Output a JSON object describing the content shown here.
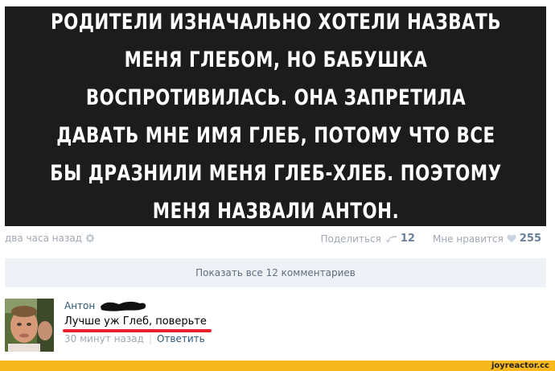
{
  "post": {
    "image_text": "Родители изначально хотели назвать меня Глебом, но бабушка воспротивилась. Она запретила давать мне имя Глеб, потому что все бы дразнили меня Глеб-хлеб. Поэтому меня назвали Антон.",
    "time": "два часа назад",
    "share_label": "Поделиться",
    "share_count": "12",
    "like_label": "Мне нравится",
    "like_count": "255"
  },
  "comments": {
    "show_all_label": "Показать все 12 комментариев",
    "items": [
      {
        "author": "Антон",
        "text": "Лучше уж Глеб, поверьте",
        "time": "30 минут назад",
        "reply_label": "Ответить"
      }
    ]
  },
  "watermark": {
    "text": "joyreactor.cc"
  },
  "icons": {
    "settings": "gear-icon",
    "share": "share-icon",
    "like": "heart-icon"
  },
  "colors": {
    "link": "#2b587a",
    "muted": "#a0a8b3",
    "underline": "#e8202a",
    "watermark_bar": "#f6b81c",
    "banner_bg": "#1c1c1c"
  }
}
